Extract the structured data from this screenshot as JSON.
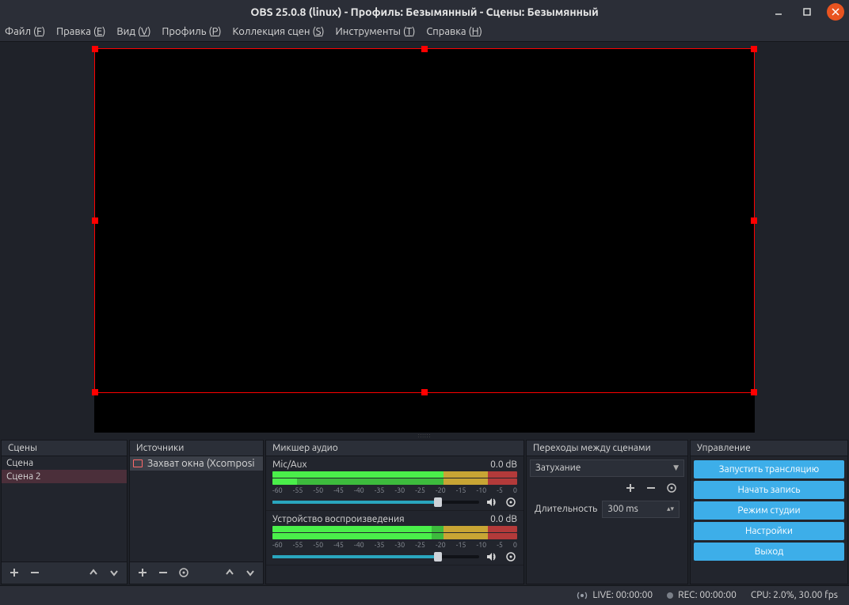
{
  "title": "OBS 25.0.8 (linux) - Профиль: Безымянный - Сцены: Безымянный",
  "menu": {
    "file": {
      "pre": "Файл (",
      "u": "F",
      "post": ")"
    },
    "edit": {
      "pre": "Правка (",
      "u": "E",
      "post": ")"
    },
    "view": {
      "pre": "Вид (",
      "u": "V",
      "post": ")"
    },
    "profile": {
      "pre": "Профиль (",
      "u": "P",
      "post": ")"
    },
    "scenecol": {
      "pre": "Коллекция сцен (",
      "u": "S",
      "post": ")"
    },
    "tools": {
      "pre": "Инструменты (",
      "u": "T",
      "post": ")"
    },
    "help": {
      "pre": "Справка (",
      "u": "H",
      "post": ")"
    }
  },
  "scenes": {
    "title": "Сцены",
    "items": [
      "Сцена",
      "Сцена 2"
    ]
  },
  "sources": {
    "title": "Источники",
    "items": [
      "Захват окна (Xcomposi"
    ]
  },
  "mixer": {
    "title": "Микшер аудио",
    "ticks": [
      "-60",
      "-55",
      "-50",
      "-45",
      "-40",
      "-35",
      "-30",
      "-25",
      "-20",
      "-15",
      "-10",
      "-5",
      "0"
    ],
    "channels": [
      {
        "name": "Mic/Aux",
        "db": "0.0 dB",
        "level_pct": 70,
        "slider_pct": 80
      },
      {
        "name": "Устройство воспроизведения",
        "db": "0.0 dB",
        "level_pct": 65,
        "slider_pct": 80
      }
    ]
  },
  "transitions": {
    "title": "Переходы между сценами",
    "selected": "Затухание",
    "duration_label": "Длительность",
    "duration_value": "300 ms"
  },
  "controls": {
    "title": "Управление",
    "buttons": [
      "Запустить трансляцию",
      "Начать запись",
      "Режим студии",
      "Настройки",
      "Выход"
    ]
  },
  "status": {
    "live": "LIVE: 00:00:00",
    "rec": "REC: 00:00:00",
    "cpu": "CPU: 2.0%, 30.00 fps"
  }
}
